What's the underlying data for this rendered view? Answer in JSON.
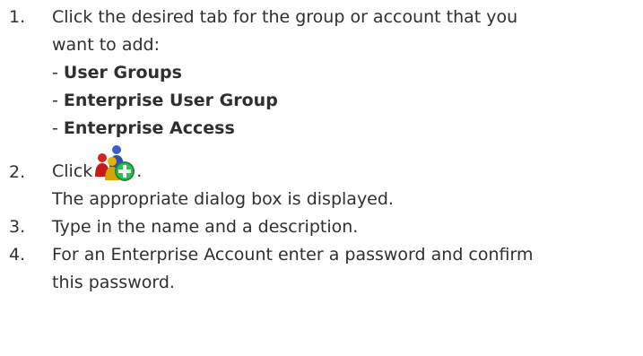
{
  "steps": [
    {
      "number": "1.",
      "lines": [
        "Click the desired tab for the group or account that you",
        "want to add:"
      ],
      "options": [
        {
          "prefix": "- ",
          "label": "User Groups"
        },
        {
          "prefix": "- ",
          "label": "Enterprise User Group"
        },
        {
          "prefix": "- ",
          "label": "Enterprise Access"
        }
      ]
    },
    {
      "number": "2.",
      "text_before_icon": "Click",
      "icon": "add-user-group-icon",
      "text_after_icon": ".",
      "result": "The appropriate dialog box is displayed."
    },
    {
      "number": "3.",
      "lines": [
        "Type in the name and a description."
      ]
    },
    {
      "number": "4.",
      "lines": [
        "For an Enterprise Account enter a password and confirm",
        "this password."
      ]
    }
  ]
}
